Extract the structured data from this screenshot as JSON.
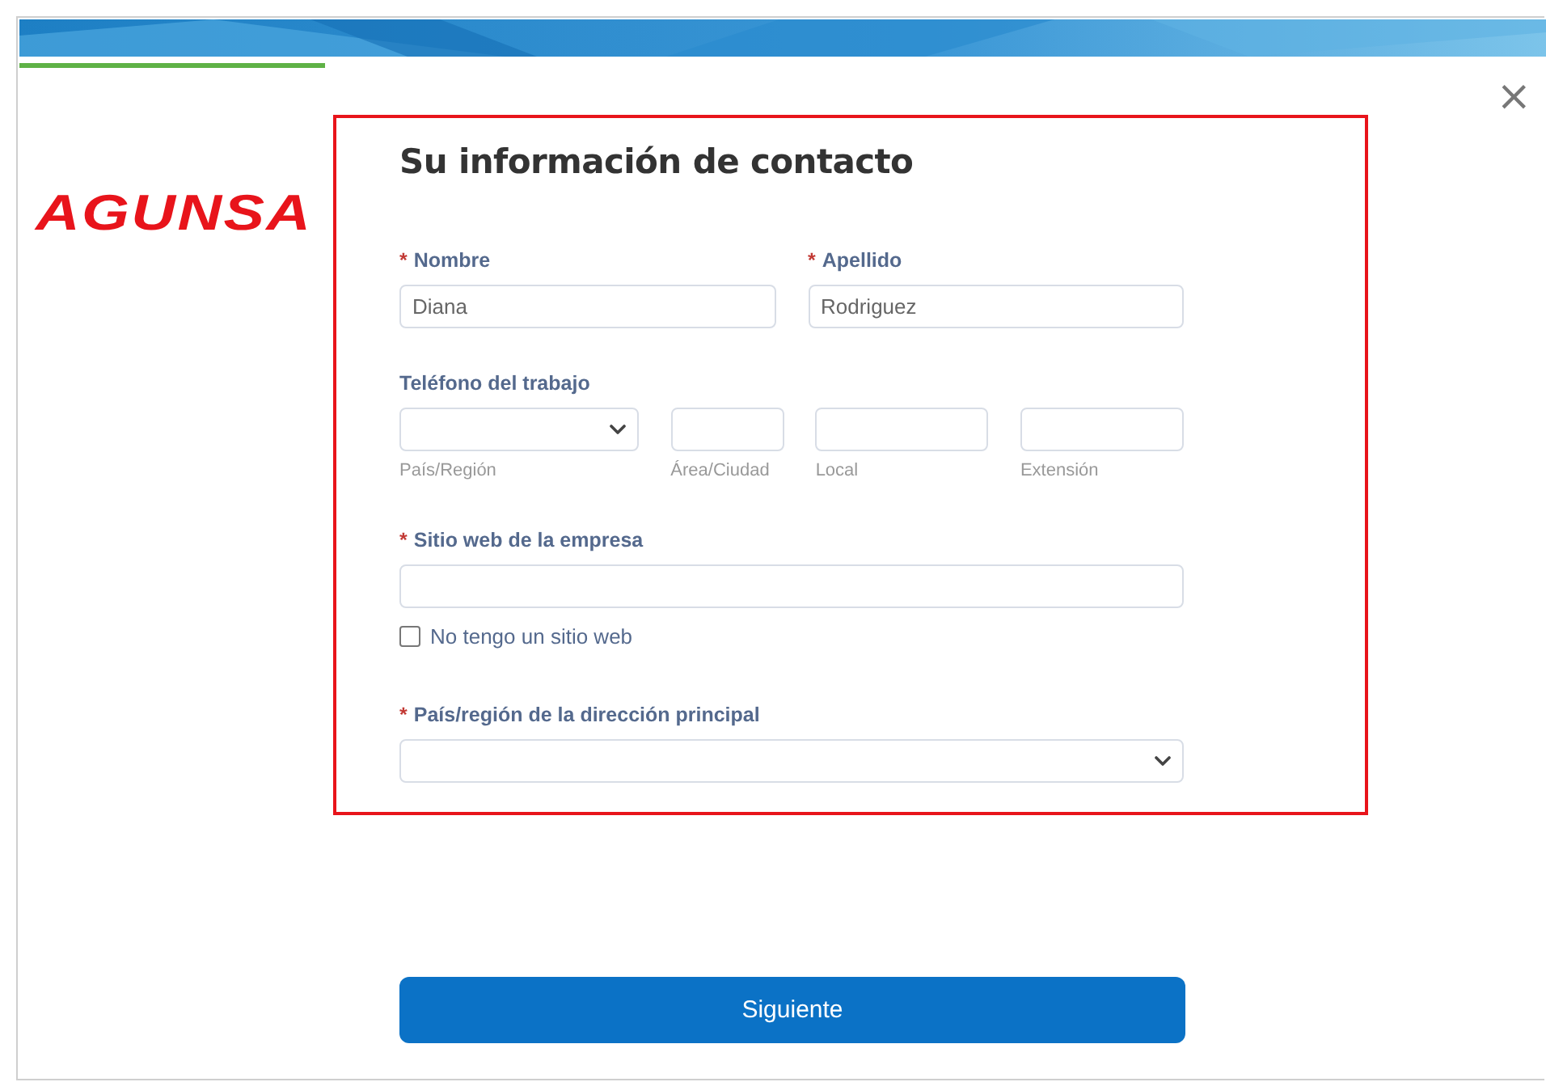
{
  "header": {
    "progress": {
      "level": 0.2
    }
  },
  "close_button": {
    "label": "×"
  },
  "logo": {
    "text": "AGUNSA"
  },
  "form": {
    "title": "Su información de contacto",
    "required_marker": "*",
    "name_fields": [
      {
        "label": "Nombre",
        "required": true,
        "value": "Diana"
      },
      {
        "label": "Apellido",
        "required": true,
        "value": "Rodriguez"
      }
    ],
    "work_phone": {
      "label": "Teléfono del trabajo",
      "required": false,
      "parts": [
        {
          "kind": "select",
          "caption": "País/Región"
        },
        {
          "kind": "text",
          "caption": "Área/Ciudad"
        },
        {
          "kind": "text",
          "caption": "Local"
        },
        {
          "kind": "text",
          "caption": "Extensión"
        }
      ]
    },
    "website": {
      "label": "Sitio web de la empresa",
      "required": true
    },
    "no_website": {
      "label": "No tengo un sitio web",
      "checked": false
    },
    "country": {
      "label": "País/región de la dirección principal",
      "required": true
    }
  },
  "submit_button": {
    "label": "Siguiente"
  }
}
